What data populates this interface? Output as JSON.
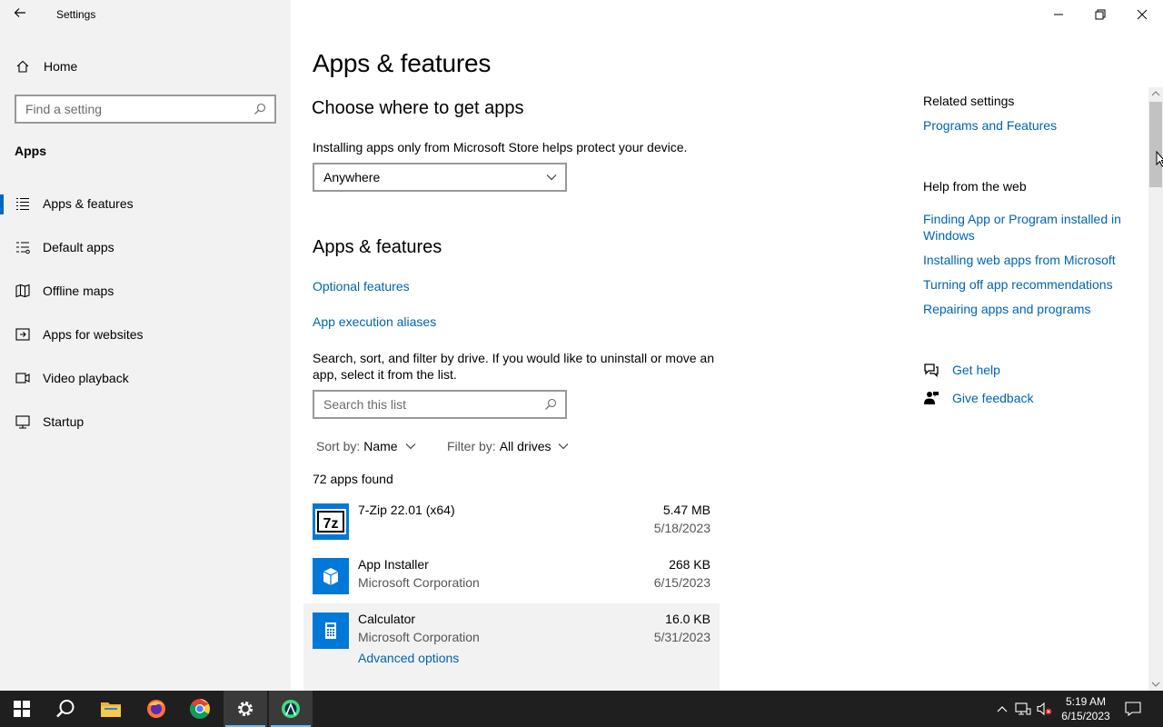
{
  "window": {
    "title": "Settings",
    "controls": {
      "minimize": "minimize",
      "restore": "restore",
      "close": "close"
    }
  },
  "sidebar": {
    "home_label": "Home",
    "search_placeholder": "Find a setting",
    "section_title": "Apps",
    "items": [
      {
        "label": "Apps & features",
        "icon": "list-icon",
        "selected": true
      },
      {
        "label": "Default apps",
        "icon": "default-apps-icon",
        "selected": false
      },
      {
        "label": "Offline maps",
        "icon": "map-icon",
        "selected": false
      },
      {
        "label": "Apps for websites",
        "icon": "website-icon",
        "selected": false
      },
      {
        "label": "Video playback",
        "icon": "video-icon",
        "selected": false
      },
      {
        "label": "Startup",
        "icon": "startup-icon",
        "selected": false
      }
    ]
  },
  "main": {
    "page_title": "Apps & features",
    "choose_heading": "Choose where to get apps",
    "choose_desc": "Installing apps only from Microsoft Store helps protect your device.",
    "source_dropdown_value": "Anywhere",
    "features_heading": "Apps & features",
    "optional_features_link": "Optional features",
    "execution_aliases_link": "App execution aliases",
    "search_desc": "Search, sort, and filter by drive. If you would like to uninstall or move an app, select it from the list.",
    "search_placeholder": "Search this list",
    "sort_label": "Sort by:",
    "sort_value": "Name",
    "filter_label": "Filter by:",
    "filter_value": "All drives",
    "apps_found": "72 apps found",
    "apps": [
      {
        "name": "7-Zip 22.01 (x64)",
        "publisher": "",
        "size": "5.47 MB",
        "date": "5/18/2023"
      },
      {
        "name": "App Installer",
        "publisher": "Microsoft Corporation",
        "size": "268 KB",
        "date": "6/15/2023"
      },
      {
        "name": "Calculator",
        "publisher": "Microsoft Corporation",
        "size": "16.0 KB",
        "date": "5/31/2023",
        "advanced_link": "Advanced options"
      }
    ]
  },
  "related": {
    "title": "Related settings",
    "programs_link": "Programs and Features",
    "help_title": "Help from the web",
    "help_links": [
      "Finding App or Program installed in Windows",
      "Installing web apps from Microsoft",
      "Turning off app recommendations",
      "Repairing apps and programs"
    ],
    "get_help": "Get help",
    "give_feedback": "Give feedback"
  },
  "taskbar": {
    "time": "5:19 AM",
    "date": "6/15/2023",
    "accent": "#0063b1"
  }
}
